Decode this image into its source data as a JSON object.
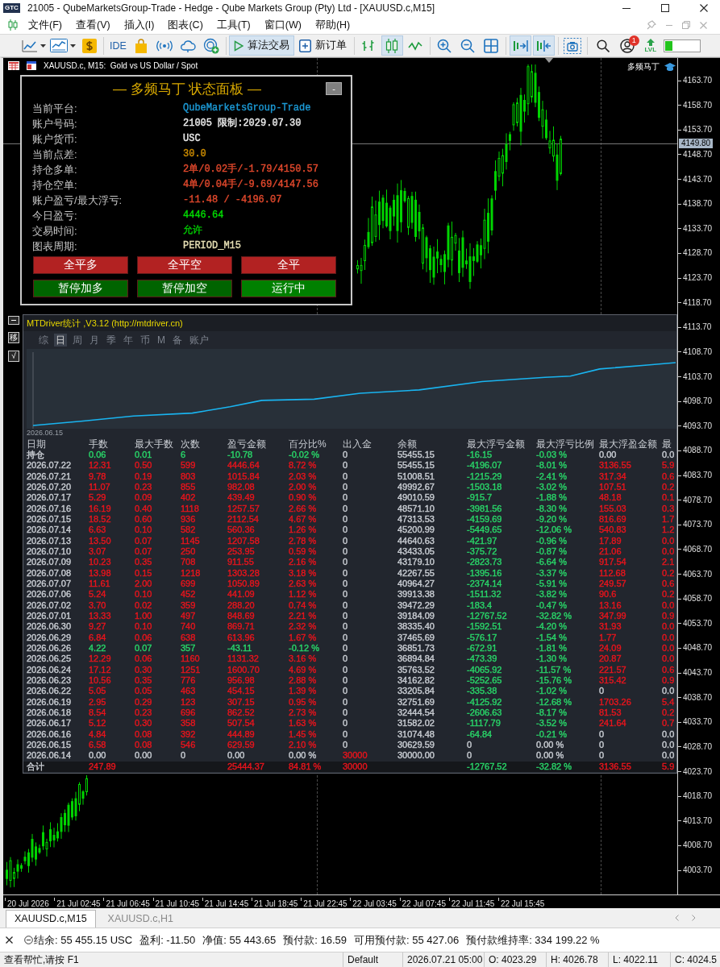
{
  "window": {
    "logo": "GTC",
    "title": "21005 - QubeMarketsGroup-Trade - Hedge - Qube Markets Group (Pty) Ltd - [XAUUSD.c,M15]"
  },
  "menu": [
    "文件(F)",
    "查看(V)",
    "插入(I)",
    "图表(C)",
    "工具(T)",
    "窗口(W)",
    "帮助(H)"
  ],
  "toolbar": {
    "ide": "IDE",
    "algo_trading": {
      "label": "算法交易",
      "on": true
    },
    "new_order": "新订单",
    "chart_types": [
      {
        "selected": false
      },
      {
        "selected": true
      },
      {
        "selected": false
      }
    ],
    "auto_scroll": {
      "on": true
    },
    "chart_shift": {
      "on": true
    },
    "notifications": {
      "badge": "1"
    },
    "level": "LVL"
  },
  "chart": {
    "header": "XAUUSD.c, M15:  Gold vs US Dollar / Spot",
    "expert": "多频马丁",
    "price_axis": [
      "4163.70",
      "4158.70",
      "4153.70",
      "4148.70",
      "4143.70",
      "4138.70",
      "4133.70",
      "4128.70",
      "4123.70",
      "4118.70",
      "4113.70",
      "4108.70",
      "4103.70",
      "4098.70",
      "4093.70",
      "4088.70",
      "4083.70",
      "4078.70",
      "4073.70",
      "4068.70",
      "4063.70",
      "4058.70",
      "4053.70",
      "4048.70",
      "4043.70",
      "4038.70",
      "4033.70",
      "4028.70",
      "4023.70",
      "4018.70",
      "4013.70",
      "4008.70",
      "4003.70"
    ],
    "current_price": "4149.80",
    "time_axis": [
      "20 Jul 2026",
      "21 Jul 02:45",
      "21 Jul 06:45",
      "21 Jul 10:45",
      "21 Jul 14:45",
      "21 Jul 18:45",
      "21 Jul 22:45",
      "22 Jul 03:45",
      "22 Jul 07:45",
      "22 Jul 11:45",
      "22 Jul 15:45"
    ],
    "status_panel": {
      "title": "— 多频马丁 状态面板 —",
      "collapse": "-",
      "rows": [
        {
          "label": "当前平台:",
          "value": "QubeMarketsGroup-Trade",
          "color": "#1c9ad6"
        },
        {
          "label": "账户号码:",
          "value": "21005 限制:2029.07.30",
          "color": "#ececec"
        },
        {
          "label": "账户货币:",
          "value": "USC",
          "color": "#ececec"
        },
        {
          "label": "当前点差:",
          "value": "30.0",
          "color": "#cc8c00"
        },
        {
          "label": "持仓多单:",
          "value": "2单/0.02手/-1.79/4150.57",
          "color": "#e0482c"
        },
        {
          "label": "持仓空单:",
          "value": "4单/0.04手/-9.69/4147.56",
          "color": "#e0482c"
        },
        {
          "label": "账户盈亏/最大浮亏:",
          "value": "-11.48 / -4196.07",
          "color": "#e0482c"
        },
        {
          "label": "今日盈亏:",
          "value": "4446.64",
          "color": "#00d800"
        },
        {
          "label": "交易时间:",
          "value": "允许",
          "color": "#00c800"
        },
        {
          "label": "图表周期:",
          "value": "PERIOD_M15",
          "color": "#e6dfb4"
        }
      ],
      "buttons": [
        {
          "label": "全平多",
          "color": "#b22222"
        },
        {
          "label": "全平空",
          "color": "#b22222"
        },
        {
          "label": "全平",
          "color": "#b22222"
        },
        {
          "label": "暂停加多",
          "color": "#006400"
        },
        {
          "label": "暂停加空",
          "color": "#006400"
        },
        {
          "label": "运行中",
          "color": "#008000"
        }
      ]
    },
    "stats_panel": {
      "side_buttons": [
        "移",
        "√"
      ],
      "title": "MTDriver统计 ,V3.12 (http://mtdriver.cn)",
      "tabs": [
        {
          "label": "综",
          "selected": false
        },
        {
          "label": "日",
          "selected": true
        },
        {
          "label": "周",
          "selected": false
        },
        {
          "label": "月",
          "selected": false
        },
        {
          "label": "季",
          "selected": false
        },
        {
          "label": "年",
          "selected": false
        },
        {
          "label": "币",
          "selected": false
        },
        {
          "label": "M",
          "selected": false
        },
        {
          "label": "备",
          "selected": false
        },
        {
          "label": "账户",
          "selected": false
        }
      ],
      "curve_start": "2026.06.15",
      "table": {
        "columns": [
          "日期",
          "手数",
          "最大手数",
          "次数",
          "盈亏金额",
          "百分比%",
          "出入金",
          "余额",
          "最大浮亏金额",
          "最大浮亏比例",
          "最大浮盈金额",
          "最"
        ],
        "rows": [
          [
            "持仓",
            {
              "text": "0.06",
              "color": "#29d468"
            },
            {
              "text": "0.01",
              "color": "#29d468"
            },
            {
              "text": "6",
              "color": "#29d468"
            },
            {
              "text": "-10.78",
              "color": "#29d468"
            },
            {
              "text": "-0.02 %",
              "color": "#29d468"
            },
            "0",
            "55455.15",
            {
              "text": "-16.15",
              "color": "#29d468"
            },
            {
              "text": "-0.03 %",
              "color": "#29d468"
            },
            "0.00",
            "0.0"
          ],
          [
            "2026.07.22",
            {
              "text": "12.31",
              "color": "#e8141c"
            },
            {
              "text": "0.50",
              "color": "#e8141c"
            },
            {
              "text": "599",
              "color": "#e8141c"
            },
            {
              "text": "4446.64",
              "color": "#e8141c"
            },
            {
              "text": "8.72 %",
              "color": "#e8141c"
            },
            "0",
            "55455.15",
            {
              "text": "-4196.07",
              "color": "#29d468"
            },
            {
              "text": "-8.01 %",
              "color": "#29d468"
            },
            {
              "text": "3136.55",
              "color": "#e8141c"
            },
            {
              "text": "5.9",
              "color": "#e8141c"
            }
          ],
          [
            "2026.07.21",
            {
              "text": "9.78",
              "color": "#e8141c"
            },
            {
              "text": "0.19",
              "color": "#e8141c"
            },
            {
              "text": "803",
              "color": "#e8141c"
            },
            {
              "text": "1015.84",
              "color": "#e8141c"
            },
            {
              "text": "2.03 %",
              "color": "#e8141c"
            },
            "0",
            "51008.51",
            {
              "text": "-1215.29",
              "color": "#29d468"
            },
            {
              "text": "-2.41 %",
              "color": "#29d468"
            },
            {
              "text": "317.34",
              "color": "#e8141c"
            },
            {
              "text": "0.6",
              "color": "#e8141c"
            }
          ],
          [
            "2026.07.20",
            {
              "text": "11.07",
              "color": "#e8141c"
            },
            {
              "text": "0.23",
              "color": "#e8141c"
            },
            {
              "text": "855",
              "color": "#e8141c"
            },
            {
              "text": "982.08",
              "color": "#e8141c"
            },
            {
              "text": "2.00 %",
              "color": "#e8141c"
            },
            "0",
            "49992.67",
            {
              "text": "-1503.18",
              "color": "#29d468"
            },
            {
              "text": "-3.02 %",
              "color": "#29d468"
            },
            {
              "text": "107.51",
              "color": "#e8141c"
            },
            {
              "text": "0.2",
              "color": "#e8141c"
            }
          ],
          [
            "2026.07.17",
            {
              "text": "5.29",
              "color": "#e8141c"
            },
            {
              "text": "0.09",
              "color": "#e8141c"
            },
            {
              "text": "402",
              "color": "#e8141c"
            },
            {
              "text": "439.49",
              "color": "#e8141c"
            },
            {
              "text": "0.90 %",
              "color": "#e8141c"
            },
            "0",
            "49010.59",
            {
              "text": "-915.7",
              "color": "#29d468"
            },
            {
              "text": "-1.88 %",
              "color": "#29d468"
            },
            {
              "text": "48.18",
              "color": "#e8141c"
            },
            {
              "text": "0.1",
              "color": "#e8141c"
            }
          ],
          [
            "2026.07.16",
            {
              "text": "16.19",
              "color": "#e8141c"
            },
            {
              "text": "0.40",
              "color": "#e8141c"
            },
            {
              "text": "1118",
              "color": "#e8141c"
            },
            {
              "text": "1257.57",
              "color": "#e8141c"
            },
            {
              "text": "2.66 %",
              "color": "#e8141c"
            },
            "0",
            "48571.10",
            {
              "text": "-3981.56",
              "color": "#29d468"
            },
            {
              "text": "-8.30 %",
              "color": "#29d468"
            },
            {
              "text": "155.03",
              "color": "#e8141c"
            },
            {
              "text": "0.3",
              "color": "#e8141c"
            }
          ],
          [
            "2026.07.15",
            {
              "text": "18.52",
              "color": "#e8141c"
            },
            {
              "text": "0.60",
              "color": "#e8141c"
            },
            {
              "text": "936",
              "color": "#e8141c"
            },
            {
              "text": "2112.54",
              "color": "#e8141c"
            },
            {
              "text": "4.67 %",
              "color": "#e8141c"
            },
            "0",
            "47313.53",
            {
              "text": "-4159.69",
              "color": "#29d468"
            },
            {
              "text": "-9.20 %",
              "color": "#29d468"
            },
            {
              "text": "816.69",
              "color": "#e8141c"
            },
            {
              "text": "1.7",
              "color": "#e8141c"
            }
          ],
          [
            "2026.07.14",
            {
              "text": "6.63",
              "color": "#e8141c"
            },
            {
              "text": "0.10",
              "color": "#e8141c"
            },
            {
              "text": "582",
              "color": "#e8141c"
            },
            {
              "text": "560.36",
              "color": "#e8141c"
            },
            {
              "text": "1.26 %",
              "color": "#e8141c"
            },
            "0",
            "45200.99",
            {
              "text": "-5449.65",
              "color": "#29d468"
            },
            {
              "text": "-12.06 %",
              "color": "#29d468"
            },
            {
              "text": "540.83",
              "color": "#e8141c"
            },
            {
              "text": "1.2",
              "color": "#e8141c"
            }
          ],
          [
            "2026.07.13",
            {
              "text": "13.50",
              "color": "#e8141c"
            },
            {
              "text": "0.07",
              "color": "#e8141c"
            },
            {
              "text": "1145",
              "color": "#e8141c"
            },
            {
              "text": "1207.58",
              "color": "#e8141c"
            },
            {
              "text": "2.78 %",
              "color": "#e8141c"
            },
            "0",
            "44640.63",
            {
              "text": "-421.97",
              "color": "#29d468"
            },
            {
              "text": "-0.96 %",
              "color": "#29d468"
            },
            {
              "text": "17.89",
              "color": "#e8141c"
            },
            {
              "text": "0.0",
              "color": "#e8141c"
            }
          ],
          [
            "2026.07.10",
            {
              "text": "3.07",
              "color": "#e8141c"
            },
            {
              "text": "0.07",
              "color": "#e8141c"
            },
            {
              "text": "250",
              "color": "#e8141c"
            },
            {
              "text": "253.95",
              "color": "#e8141c"
            },
            {
              "text": "0.59 %",
              "color": "#e8141c"
            },
            "0",
            "43433.05",
            {
              "text": "-375.72",
              "color": "#29d468"
            },
            {
              "text": "-0.87 %",
              "color": "#29d468"
            },
            {
              "text": "21.06",
              "color": "#e8141c"
            },
            {
              "text": "0.0",
              "color": "#e8141c"
            }
          ],
          [
            "2026.07.09",
            {
              "text": "10.23",
              "color": "#e8141c"
            },
            {
              "text": "0.35",
              "color": "#e8141c"
            },
            {
              "text": "708",
              "color": "#e8141c"
            },
            {
              "text": "911.55",
              "color": "#e8141c"
            },
            {
              "text": "2.16 %",
              "color": "#e8141c"
            },
            "0",
            "43179.10",
            {
              "text": "-2823.73",
              "color": "#29d468"
            },
            {
              "text": "-6.64 %",
              "color": "#29d468"
            },
            {
              "text": "917.54",
              "color": "#e8141c"
            },
            {
              "text": "2.1",
              "color": "#e8141c"
            }
          ],
          [
            "2026.07.08",
            {
              "text": "13.98",
              "color": "#e8141c"
            },
            {
              "text": "0.15",
              "color": "#e8141c"
            },
            {
              "text": "1218",
              "color": "#e8141c"
            },
            {
              "text": "1303.28",
              "color": "#e8141c"
            },
            {
              "text": "3.18 %",
              "color": "#e8141c"
            },
            "0",
            "42267.55",
            {
              "text": "-1395.16",
              "color": "#29d468"
            },
            {
              "text": "-3.37 %",
              "color": "#29d468"
            },
            {
              "text": "112.68",
              "color": "#e8141c"
            },
            {
              "text": "0.2",
              "color": "#e8141c"
            }
          ],
          [
            "2026.07.07",
            {
              "text": "11.61",
              "color": "#e8141c"
            },
            {
              "text": "2.00",
              "color": "#e8141c"
            },
            {
              "text": "699",
              "color": "#e8141c"
            },
            {
              "text": "1050.89",
              "color": "#e8141c"
            },
            {
              "text": "2.63 %",
              "color": "#e8141c"
            },
            "0",
            "40964.27",
            {
              "text": "-2374.14",
              "color": "#29d468"
            },
            {
              "text": "-5.91 %",
              "color": "#29d468"
            },
            {
              "text": "249.57",
              "color": "#e8141c"
            },
            {
              "text": "0.6",
              "color": "#e8141c"
            }
          ],
          [
            "2026.07.06",
            {
              "text": "5.24",
              "color": "#e8141c"
            },
            {
              "text": "0.10",
              "color": "#e8141c"
            },
            {
              "text": "452",
              "color": "#e8141c"
            },
            {
              "text": "441.09",
              "color": "#e8141c"
            },
            {
              "text": "1.12 %",
              "color": "#e8141c"
            },
            "0",
            "39913.38",
            {
              "text": "-1511.32",
              "color": "#29d468"
            },
            {
              "text": "-3.82 %",
              "color": "#29d468"
            },
            {
              "text": "90.6",
              "color": "#e8141c"
            },
            {
              "text": "0.2",
              "color": "#e8141c"
            }
          ],
          [
            "2026.07.02",
            {
              "text": "3.70",
              "color": "#e8141c"
            },
            {
              "text": "0.02",
              "color": "#e8141c"
            },
            {
              "text": "359",
              "color": "#e8141c"
            },
            {
              "text": "288.20",
              "color": "#e8141c"
            },
            {
              "text": "0.74 %",
              "color": "#e8141c"
            },
            "0",
            "39472.29",
            {
              "text": "-183.4",
              "color": "#29d468"
            },
            {
              "text": "-0.47 %",
              "color": "#29d468"
            },
            {
              "text": "13.16",
              "color": "#e8141c"
            },
            {
              "text": "0.0",
              "color": "#e8141c"
            }
          ],
          [
            "2026.07.01",
            {
              "text": "13.33",
              "color": "#e8141c"
            },
            {
              "text": "1.00",
              "color": "#e8141c"
            },
            {
              "text": "497",
              "color": "#e8141c"
            },
            {
              "text": "848.69",
              "color": "#e8141c"
            },
            {
              "text": "2.21 %",
              "color": "#e8141c"
            },
            "0",
            "39184.09",
            {
              "text": "-12767.52",
              "color": "#29d468"
            },
            {
              "text": "-32.82 %",
              "color": "#29d468"
            },
            {
              "text": "347.99",
              "color": "#e8141c"
            },
            {
              "text": "0.9",
              "color": "#e8141c"
            }
          ],
          [
            "2026.06.30",
            {
              "text": "9.27",
              "color": "#e8141c"
            },
            {
              "text": "0.10",
              "color": "#e8141c"
            },
            {
              "text": "740",
              "color": "#e8141c"
            },
            {
              "text": "869.71",
              "color": "#e8141c"
            },
            {
              "text": "2.32 %",
              "color": "#e8141c"
            },
            "0",
            "38335.40",
            {
              "text": "-1592.51",
              "color": "#29d468"
            },
            {
              "text": "-4.20 %",
              "color": "#29d468"
            },
            {
              "text": "31.93",
              "color": "#e8141c"
            },
            {
              "text": "0.0",
              "color": "#e8141c"
            }
          ],
          [
            "2026.06.29",
            {
              "text": "6.84",
              "color": "#e8141c"
            },
            {
              "text": "0.06",
              "color": "#e8141c"
            },
            {
              "text": "638",
              "color": "#e8141c"
            },
            {
              "text": "613.96",
              "color": "#e8141c"
            },
            {
              "text": "1.67 %",
              "color": "#e8141c"
            },
            "0",
            "37465.69",
            {
              "text": "-576.17",
              "color": "#29d468"
            },
            {
              "text": "-1.54 %",
              "color": "#29d468"
            },
            {
              "text": "1.77",
              "color": "#e8141c"
            },
            {
              "text": "0.0",
              "color": "#e8141c"
            }
          ],
          [
            "2026.06.26",
            {
              "text": "4.22",
              "color": "#29d468"
            },
            {
              "text": "0.07",
              "color": "#29d468"
            },
            {
              "text": "357",
              "color": "#29d468"
            },
            {
              "text": "-43.11",
              "color": "#29d468"
            },
            {
              "text": "-0.12 %",
              "color": "#29d468"
            },
            "0",
            "36851.73",
            {
              "text": "-672.91",
              "color": "#29d468"
            },
            {
              "text": "-1.81 %",
              "color": "#29d468"
            },
            {
              "text": "24.09",
              "color": "#e8141c"
            },
            {
              "text": "0.0",
              "color": "#e8141c"
            }
          ],
          [
            "2026.06.25",
            {
              "text": "12.29",
              "color": "#e8141c"
            },
            {
              "text": "0.06",
              "color": "#e8141c"
            },
            {
              "text": "1160",
              "color": "#e8141c"
            },
            {
              "text": "1131.32",
              "color": "#e8141c"
            },
            {
              "text": "3.16 %",
              "color": "#e8141c"
            },
            "0",
            "36894.84",
            {
              "text": "-473.39",
              "color": "#29d468"
            },
            {
              "text": "-1.30 %",
              "color": "#29d468"
            },
            {
              "text": "20.87",
              "color": "#e8141c"
            },
            {
              "text": "0.0",
              "color": "#e8141c"
            }
          ],
          [
            "2026.06.24",
            {
              "text": "17.12",
              "color": "#e8141c"
            },
            {
              "text": "0.30",
              "color": "#e8141c"
            },
            {
              "text": "1251",
              "color": "#e8141c"
            },
            {
              "text": "1600.70",
              "color": "#e8141c"
            },
            {
              "text": "4.69 %",
              "color": "#e8141c"
            },
            "0",
            "35763.52",
            {
              "text": "-4065.92",
              "color": "#29d468"
            },
            {
              "text": "-11.57 %",
              "color": "#29d468"
            },
            {
              "text": "221.57",
              "color": "#e8141c"
            },
            {
              "text": "0.6",
              "color": "#e8141c"
            }
          ],
          [
            "2026.06.23",
            {
              "text": "10.56",
              "color": "#e8141c"
            },
            {
              "text": "0.35",
              "color": "#e8141c"
            },
            {
              "text": "776",
              "color": "#e8141c"
            },
            {
              "text": "956.98",
              "color": "#e8141c"
            },
            {
              "text": "2.88 %",
              "color": "#e8141c"
            },
            "0",
            "34162.82",
            {
              "text": "-5252.65",
              "color": "#29d468"
            },
            {
              "text": "-15.76 %",
              "color": "#29d468"
            },
            {
              "text": "315.42",
              "color": "#e8141c"
            },
            {
              "text": "0.9",
              "color": "#e8141c"
            }
          ],
          [
            "2026.06.22",
            {
              "text": "5.05",
              "color": "#e8141c"
            },
            {
              "text": "0.05",
              "color": "#e8141c"
            },
            {
              "text": "463",
              "color": "#e8141c"
            },
            {
              "text": "454.15",
              "color": "#e8141c"
            },
            {
              "text": "1.39 %",
              "color": "#e8141c"
            },
            "0",
            "33205.84",
            {
              "text": "-335.38",
              "color": "#29d468"
            },
            {
              "text": "-1.02 %",
              "color": "#29d468"
            },
            "0",
            "0.0"
          ],
          [
            "2026.06.19",
            {
              "text": "2.95",
              "color": "#e8141c"
            },
            {
              "text": "0.29",
              "color": "#e8141c"
            },
            {
              "text": "123",
              "color": "#e8141c"
            },
            {
              "text": "307.15",
              "color": "#e8141c"
            },
            {
              "text": "0.95 %",
              "color": "#e8141c"
            },
            "0",
            "32751.69",
            {
              "text": "-4125.92",
              "color": "#29d468"
            },
            {
              "text": "-12.68 %",
              "color": "#29d468"
            },
            {
              "text": "1703.26",
              "color": "#e8141c"
            },
            {
              "text": "5.4",
              "color": "#e8141c"
            }
          ],
          [
            "2026.06.18",
            {
              "text": "8.54",
              "color": "#e8141c"
            },
            {
              "text": "0.23",
              "color": "#e8141c"
            },
            {
              "text": "696",
              "color": "#e8141c"
            },
            {
              "text": "862.52",
              "color": "#e8141c"
            },
            {
              "text": "2.73 %",
              "color": "#e8141c"
            },
            "0",
            "32444.54",
            {
              "text": "-2606.63",
              "color": "#29d468"
            },
            {
              "text": "-8.17 %",
              "color": "#29d468"
            },
            {
              "text": "81.53",
              "color": "#e8141c"
            },
            {
              "text": "0.2",
              "color": "#e8141c"
            }
          ],
          [
            "2026.06.17",
            {
              "text": "5.12",
              "color": "#e8141c"
            },
            {
              "text": "0.30",
              "color": "#e8141c"
            },
            {
              "text": "358",
              "color": "#e8141c"
            },
            {
              "text": "507.54",
              "color": "#e8141c"
            },
            {
              "text": "1.63 %",
              "color": "#e8141c"
            },
            "0",
            "31582.02",
            {
              "text": "-1117.79",
              "color": "#29d468"
            },
            {
              "text": "-3.52 %",
              "color": "#29d468"
            },
            {
              "text": "241.64",
              "color": "#e8141c"
            },
            {
              "text": "0.7",
              "color": "#e8141c"
            }
          ],
          [
            "2026.06.16",
            {
              "text": "4.84",
              "color": "#e8141c"
            },
            {
              "text": "0.08",
              "color": "#e8141c"
            },
            {
              "text": "392",
              "color": "#e8141c"
            },
            {
              "text": "444.89",
              "color": "#e8141c"
            },
            {
              "text": "1.45 %",
              "color": "#e8141c"
            },
            "0",
            "31074.48",
            {
              "text": "-64.84",
              "color": "#29d468"
            },
            {
              "text": "-0.21 %",
              "color": "#29d468"
            },
            "0",
            "0.0"
          ],
          [
            "2026.06.15",
            {
              "text": "6.58",
              "color": "#e8141c"
            },
            {
              "text": "0.08",
              "color": "#e8141c"
            },
            {
              "text": "546",
              "color": "#e8141c"
            },
            {
              "text": "629.59",
              "color": "#e8141c"
            },
            {
              "text": "2.10 %",
              "color": "#e8141c"
            },
            "0",
            "30629.59",
            "0",
            "0.00 %",
            "0",
            "0.0"
          ],
          [
            "2026.06.14",
            "0.00",
            "0.00",
            "0",
            "0.00",
            "0.00 %",
            {
              "text": "30000",
              "color": "#e8141c"
            },
            "30000.00",
            "0",
            "0.00 %",
            "0",
            "0.0"
          ]
        ],
        "total": {
          "label": "合计",
          "lots": {
            "text": "247.89",
            "color": "#e8141c"
          },
          "pnl": {
            "text": "25444.37",
            "color": "#e8141c"
          },
          "percent": {
            "text": "84.81 %",
            "color": "#e8141c"
          },
          "deposit": {
            "text": "30000",
            "color": "#e8141c"
          },
          "max_floating_loss": {
            "text": "-12767.52",
            "color": "#29d468"
          },
          "max_floating_loss_ratio": {
            "text": "-32.82 %",
            "color": "#29d468"
          },
          "max_floating_profit": {
            "text": "3136.55",
            "color": "#e8141c"
          },
          "column_12": {
            "text": "5.9",
            "color": "#e8141c"
          }
        }
      }
    }
  },
  "tabs": [
    {
      "label": "XAUUSD.c,M15",
      "selected": true
    },
    {
      "label": "XAUUSD.c,H1",
      "selected": false
    }
  ],
  "account": [
    {
      "label": "结余:",
      "value": "55 455.15 USC"
    },
    {
      "label": "盈利:",
      "value": "-11.50"
    },
    {
      "label": "净值:",
      "value": "55 443.65"
    },
    {
      "label": "预付款:",
      "value": "16.59"
    },
    {
      "label": "可用预付款:",
      "value": "55 427.06"
    },
    {
      "label": "预付款维持率:",
      "value": "334 199.22 %"
    }
  ],
  "status_bar": {
    "help": "查看帮忙,请按 F1",
    "fields": [
      "Default",
      "2026.07.21 05:00",
      "O: 4023.29",
      "H: 4026.78",
      "L: 4022.11",
      "C: 4024.5"
    ]
  }
}
